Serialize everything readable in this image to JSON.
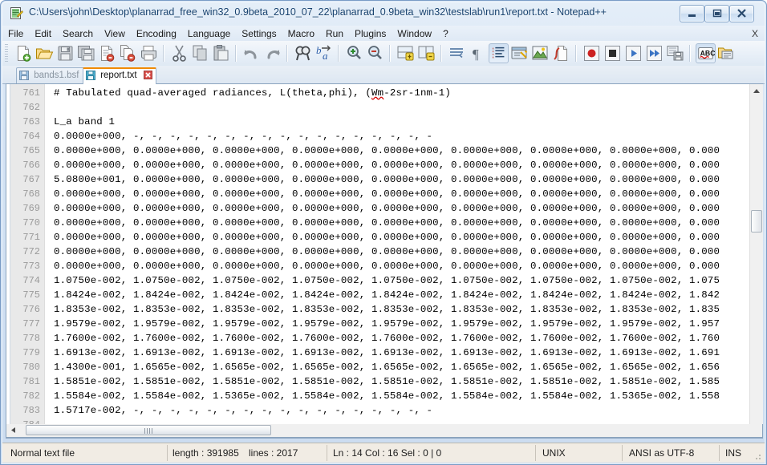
{
  "window": {
    "title": "C:\\Users\\john\\Desktop\\planarrad_free_win32_0.9beta_2010_07_22\\planarrad_0.9beta_win32\\testslab\\run1\\report.txt - Notepad++",
    "app_name": "Notepad++",
    "controls": {
      "minimize": "minimize-button",
      "maximize": "restore-button",
      "close": "close-button"
    }
  },
  "menu": {
    "items": [
      {
        "label": "File"
      },
      {
        "label": "Edit"
      },
      {
        "label": "Search"
      },
      {
        "label": "View"
      },
      {
        "label": "Encoding"
      },
      {
        "label": "Language"
      },
      {
        "label": "Settings"
      },
      {
        "label": "Macro"
      },
      {
        "label": "Run"
      },
      {
        "label": "Plugins"
      },
      {
        "label": "Window"
      },
      {
        "label": "?"
      }
    ],
    "close_document_label": "X"
  },
  "toolbar": {
    "buttons": [
      "new-file-icon",
      "open-file-icon",
      "save-icon",
      "save-all-icon",
      "close-file-icon",
      "close-all-files-icon",
      "print-icon",
      "cut-icon",
      "copy-icon",
      "paste-icon",
      "undo-icon",
      "redo-icon",
      "find-icon",
      "replace-icon",
      "zoom-in-icon",
      "zoom-out-icon",
      "sync-vertical-scroll-icon",
      "sync-horizontal-scroll-icon",
      "word-wrap-icon",
      "invisible-characters-icon",
      "indent-guide-icon",
      "user-defined-dialog-icon",
      "show-all-characters-icon",
      "function-list-icon",
      "record-macro-icon",
      "stop-recording-icon",
      "play-macro-icon",
      "run-macro-multiple-icon",
      "save-macro-icon",
      "spell-check-icon",
      "document-map-icon"
    ]
  },
  "tabs": [
    {
      "label": "bands1.bsf",
      "active": false
    },
    {
      "label": "report.txt",
      "active": true
    }
  ],
  "editor": {
    "first_line_number": 761,
    "lines": [
      {
        "n": "761",
        "text": "# Tabulated quad-averaged radiances, L(theta,phi), (Wm-2sr-1nm-1)",
        "misspelled": "Wm"
      },
      {
        "n": "762",
        "text": ""
      },
      {
        "n": "763",
        "text": "L_a band 1"
      },
      {
        "n": "764",
        "text": "0.0000e+000, -, -, -, -, -, -, -, -, -, -, -, -, -, -, -, -, -"
      },
      {
        "n": "765",
        "text": "0.0000e+000, 0.0000e+000, 0.0000e+000, 0.0000e+000, 0.0000e+000, 0.0000e+000, 0.0000e+000, 0.0000e+000, 0.000"
      },
      {
        "n": "766",
        "text": "0.0000e+000, 0.0000e+000, 0.0000e+000, 0.0000e+000, 0.0000e+000, 0.0000e+000, 0.0000e+000, 0.0000e+000, 0.000"
      },
      {
        "n": "767",
        "text": "5.0800e+001, 0.0000e+000, 0.0000e+000, 0.0000e+000, 0.0000e+000, 0.0000e+000, 0.0000e+000, 0.0000e+000, 0.000"
      },
      {
        "n": "768",
        "text": "0.0000e+000, 0.0000e+000, 0.0000e+000, 0.0000e+000, 0.0000e+000, 0.0000e+000, 0.0000e+000, 0.0000e+000, 0.000"
      },
      {
        "n": "769",
        "text": "0.0000e+000, 0.0000e+000, 0.0000e+000, 0.0000e+000, 0.0000e+000, 0.0000e+000, 0.0000e+000, 0.0000e+000, 0.000"
      },
      {
        "n": "770",
        "text": "0.0000e+000, 0.0000e+000, 0.0000e+000, 0.0000e+000, 0.0000e+000, 0.0000e+000, 0.0000e+000, 0.0000e+000, 0.000"
      },
      {
        "n": "771",
        "text": "0.0000e+000, 0.0000e+000, 0.0000e+000, 0.0000e+000, 0.0000e+000, 0.0000e+000, 0.0000e+000, 0.0000e+000, 0.000"
      },
      {
        "n": "772",
        "text": "0.0000e+000, 0.0000e+000, 0.0000e+000, 0.0000e+000, 0.0000e+000, 0.0000e+000, 0.0000e+000, 0.0000e+000, 0.000"
      },
      {
        "n": "773",
        "text": "0.0000e+000, 0.0000e+000, 0.0000e+000, 0.0000e+000, 0.0000e+000, 0.0000e+000, 0.0000e+000, 0.0000e+000, 0.000"
      },
      {
        "n": "774",
        "text": "1.0750e-002, 1.0750e-002, 1.0750e-002, 1.0750e-002, 1.0750e-002, 1.0750e-002, 1.0750e-002, 1.0750e-002, 1.075"
      },
      {
        "n": "775",
        "text": "1.8424e-002, 1.8424e-002, 1.8424e-002, 1.8424e-002, 1.8424e-002, 1.8424e-002, 1.8424e-002, 1.8424e-002, 1.842"
      },
      {
        "n": "776",
        "text": "1.8353e-002, 1.8353e-002, 1.8353e-002, 1.8353e-002, 1.8353e-002, 1.8353e-002, 1.8353e-002, 1.8353e-002, 1.835"
      },
      {
        "n": "777",
        "text": "1.9579e-002, 1.9579e-002, 1.9579e-002, 1.9579e-002, 1.9579e-002, 1.9579e-002, 1.9579e-002, 1.9579e-002, 1.957"
      },
      {
        "n": "778",
        "text": "1.7600e-002, 1.7600e-002, 1.7600e-002, 1.7600e-002, 1.7600e-002, 1.7600e-002, 1.7600e-002, 1.7600e-002, 1.760"
      },
      {
        "n": "779",
        "text": "1.6913e-002, 1.6913e-002, 1.6913e-002, 1.6913e-002, 1.6913e-002, 1.6913e-002, 1.6913e-002, 1.6913e-002, 1.691"
      },
      {
        "n": "780",
        "text": "1.4300e-001, 1.6565e-002, 1.6565e-002, 1.6565e-002, 1.6565e-002, 1.6565e-002, 1.6565e-002, 1.6565e-002, 1.656"
      },
      {
        "n": "781",
        "text": "1.5851e-002, 1.5851e-002, 1.5851e-002, 1.5851e-002, 1.5851e-002, 1.5851e-002, 1.5851e-002, 1.5851e-002, 1.585"
      },
      {
        "n": "782",
        "text": "1.5584e-002, 1.5584e-002, 1.5365e-002, 1.5584e-002, 1.5584e-002, 1.5584e-002, 1.5584e-002, 1.5365e-002, 1.558"
      },
      {
        "n": "783",
        "text": "1.5717e-002, -, -, -, -, -, -, -, -, -, -, -, -, -, -, -, -, -"
      },
      {
        "n": "784",
        "text": ""
      }
    ]
  },
  "status_bar": {
    "file_type": "Normal text file",
    "length_label": "length : 391985",
    "lines_label": "lines : 2017",
    "caret": "Ln : 14    Col : 16    Sel : 0 | 0",
    "eol": "UNIX",
    "encoding": "ANSI as UTF-8",
    "insert_mode": "INS"
  },
  "colors": {
    "accent_tab": "#f08a00",
    "title_text": "#16416e",
    "gutter_bg": "#e9e9e9",
    "status_bg": "#f1ece4",
    "spell_underline": "#d40000"
  }
}
